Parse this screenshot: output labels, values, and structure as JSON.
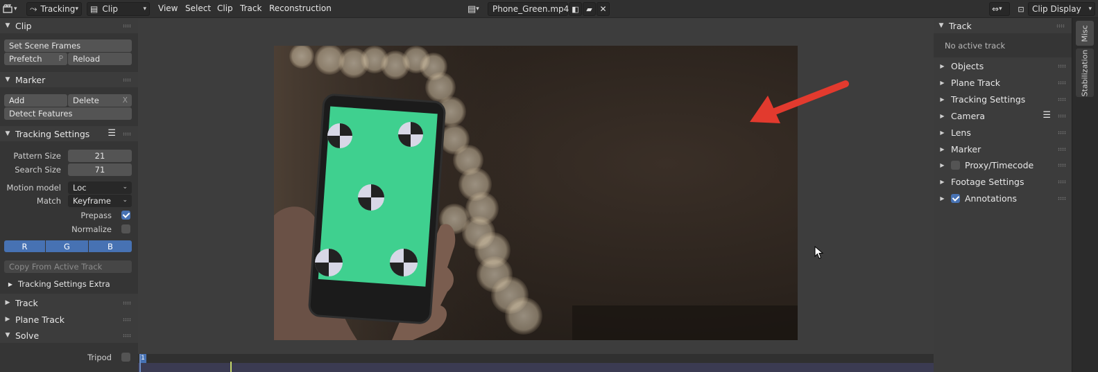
{
  "topbar": {
    "editor_type_icon": "clip-editor-icon",
    "mode": "Tracking",
    "view_mode": "Clip",
    "menus": [
      "View",
      "Select",
      "Clip",
      "Track",
      "Reconstruction"
    ],
    "clip_name": "Phone_Green.mp4",
    "display_label": "Clip Display"
  },
  "left": {
    "clip_header": "Clip",
    "set_scene_frames": "Set Scene Frames",
    "prefetch": "Prefetch",
    "prefetch_key": "P",
    "reload": "Reload",
    "marker_header": "Marker",
    "add": "Add",
    "delete": "Delete",
    "delete_key": "X",
    "detect_features": "Detect Features",
    "tracking_settings_header": "Tracking Settings",
    "pattern_size_label": "Pattern Size",
    "pattern_size": "21",
    "search_size_label": "Search Size",
    "search_size": "71",
    "motion_model_label": "Motion model",
    "motion_model": "Loc",
    "match_label": "Match",
    "match": "Keyframe",
    "prepass_label": "Prepass",
    "prepass": true,
    "normalize_label": "Normalize",
    "normalize": false,
    "channels": [
      "R",
      "G",
      "B"
    ],
    "copy_from_active": "Copy From Active Track",
    "tracking_settings_extra": "Tracking Settings Extra",
    "track_header": "Track",
    "plane_track_header": "Plane Track",
    "solve_header": "Solve",
    "tripod_label": "Tripod",
    "tripod": false
  },
  "right": {
    "track_header": "Track",
    "no_active_track": "No active track",
    "items": [
      "Objects",
      "Plane Track",
      "Tracking Settings",
      "Camera",
      "Lens",
      "Marker",
      "Proxy/Timecode",
      "Footage Settings",
      "Annotations"
    ],
    "proxy_checked": false,
    "annotations_checked": true
  },
  "tabs": [
    "Misc",
    "Stabilization"
  ],
  "timeline": {
    "current_frame": "1"
  },
  "colors": {
    "accent": "#4772b3",
    "arrow": "#e23a2e",
    "green_screen": "#3fd08f"
  }
}
